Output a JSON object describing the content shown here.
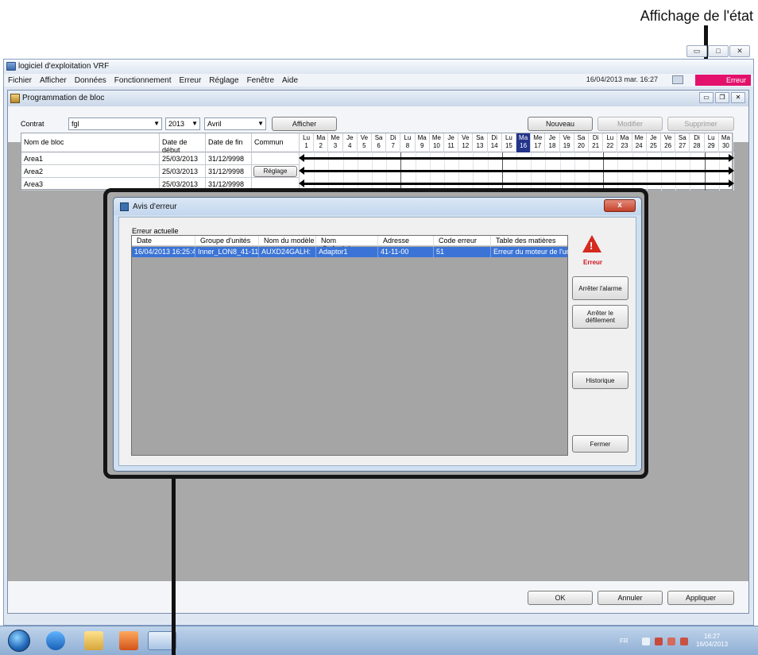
{
  "annotations": {
    "status_display_label": "Affichage de l'état"
  },
  "app": {
    "title": "logiciel d'exploitation VRF",
    "menu": [
      "Fichier",
      "Afficher",
      "Données",
      "Fonctionnement",
      "Erreur",
      "Réglage",
      "Fenêtre",
      "Aide"
    ],
    "datetime": "16/04/2013 mar. 16:27",
    "error_status": "Erreur",
    "status_color": "#e3116c"
  },
  "block_window": {
    "title": "Programmation de bloc",
    "contract_label": "Contrat",
    "contract_value": "fgl",
    "year_value": "2013",
    "month_value": "Avril",
    "show_button": "Afficher",
    "new_button": "Nouveau",
    "edit_button": "Modifier",
    "delete_button": "Supprimer",
    "columns": [
      "Nom de bloc",
      "Date de début",
      "Date de fin",
      "Commun"
    ],
    "rows": [
      {
        "name": "Area1",
        "start": "25/03/2013",
        "end": "31/12/9998",
        "common": ""
      },
      {
        "name": "Area2",
        "start": "25/03/2013",
        "end": "31/12/9998",
        "common": "Réglage"
      },
      {
        "name": "Area3",
        "start": "25/03/2013",
        "end": "31/12/9998",
        "common": ""
      }
    ],
    "day_names": [
      "Lu",
      "Ma",
      "Me",
      "Je",
      "Ve",
      "Sa",
      "Di",
      "Lu",
      "Ma",
      "Me",
      "Je",
      "Ve",
      "Sa",
      "Di",
      "Lu",
      "Ma",
      "Me",
      "Je",
      "Ve",
      "Sa",
      "Di",
      "Lu",
      "Ma",
      "Me",
      "Je",
      "Ve",
      "Sa",
      "Di",
      "Lu",
      "Ma"
    ],
    "day_numbers": [
      "1",
      "2",
      "3",
      "4",
      "5",
      "6",
      "7",
      "8",
      "9",
      "10",
      "11",
      "12",
      "13",
      "14",
      "15",
      "16",
      "17",
      "18",
      "19",
      "20",
      "21",
      "22",
      "23",
      "24",
      "25",
      "26",
      "27",
      "28",
      "29",
      "30"
    ],
    "highlighted_day": "16",
    "ok_button": "OK",
    "cancel_button": "Annuler",
    "apply_button": "Appliquer"
  },
  "dialog": {
    "title": "Avis d'erreur",
    "close_glyph": "x",
    "section_label": "Erreur actuelle",
    "columns": [
      "Date",
      "Groupe d'unités",
      "Nom du modèle",
      "Nom d'adaptateur",
      "Adresse",
      "Code erreur",
      "Table des matières"
    ],
    "rows": [
      [
        "16/04/2013 16:25:42",
        "Inner_LON8_41-11",
        "AUXD24GALH:",
        "Adaptor1",
        "41-11-00",
        "51",
        "Erreur du moteur de l'un..."
      ]
    ],
    "error_label": "Erreur",
    "stop_alarm_button": "Arrêter l'alarme",
    "stop_scroll_button": "Arrêter le défilement",
    "history_button": "Historique",
    "close_button": "Fermer"
  },
  "taskbar": {
    "language": "FR",
    "time": "16:27",
    "date": "16/04/2013"
  }
}
